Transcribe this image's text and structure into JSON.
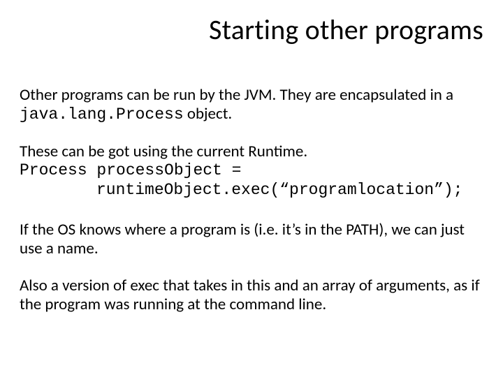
{
  "title": "Starting other programs",
  "para1_pre": "Other programs can be run by the JVM. They are encapsulated in a ",
  "para1_code": "java.lang.Process",
  "para1_post": " object.",
  "para2": "These can be got using the current Runtime.",
  "code_line1": "Process processObject =",
  "code_line2": "runtimeObject.exec(“programlocation”);",
  "para3": "If the OS knows where a program is (i.e. it’s in the PATH), we can just use a name.",
  "para4": "Also a version of exec that takes in this and an array of arguments, as if the program was running at the command line."
}
